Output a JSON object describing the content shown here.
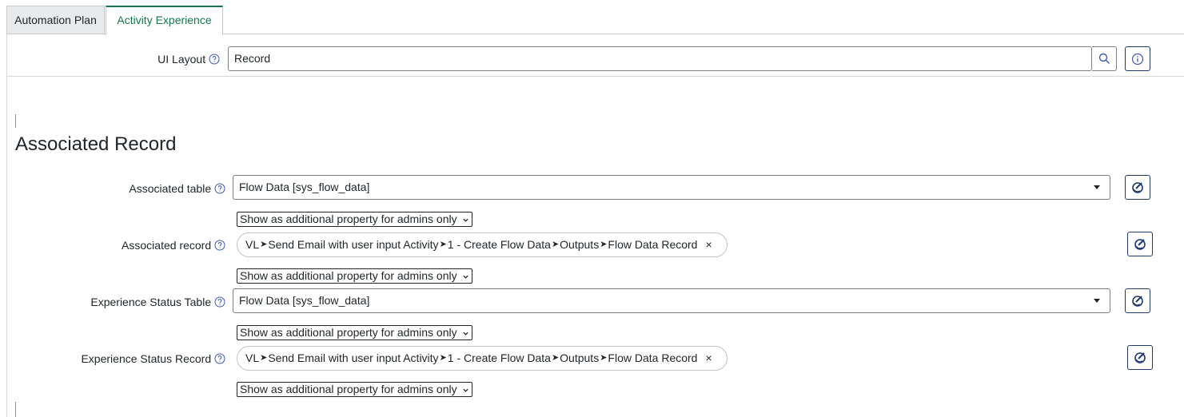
{
  "tabs": [
    {
      "label": "Automation Plan"
    },
    {
      "label": "Activity Experience"
    }
  ],
  "ui_layout": {
    "label": "UI Layout",
    "value": "Record"
  },
  "section": {
    "title": "Associated Record"
  },
  "fields": {
    "associated_table": {
      "label": "Associated table",
      "value": "Flow Data [sys_flow_data]"
    },
    "associated_record": {
      "label": "Associated record",
      "pill_parts": [
        "VL",
        "Send Email with user input Activity",
        "1 - Create Flow Data",
        "Outputs",
        "Flow Data Record"
      ],
      "remove": "×"
    },
    "experience_status_table": {
      "label": "Experience Status Table",
      "value": "Flow Data [sys_flow_data]"
    },
    "experience_status_record": {
      "label": "Experience Status Record",
      "pill_parts": [
        "VL",
        "Send Email with user input Activity",
        "1 - Create Flow Data",
        "Outputs",
        "Flow Data Record"
      ],
      "remove": "×"
    }
  },
  "visibility_option": "Show as additional property for admins only",
  "colors": {
    "active_tab": "#137a4c",
    "accent_button": "#1d3a73",
    "border": "#7a8185"
  },
  "icons": {
    "help": "question-circle-icon",
    "search": "search-icon",
    "info": "info-icon",
    "data_pill_picker": "data-pill-picker-icon",
    "separator": "arrow-right-icon"
  }
}
